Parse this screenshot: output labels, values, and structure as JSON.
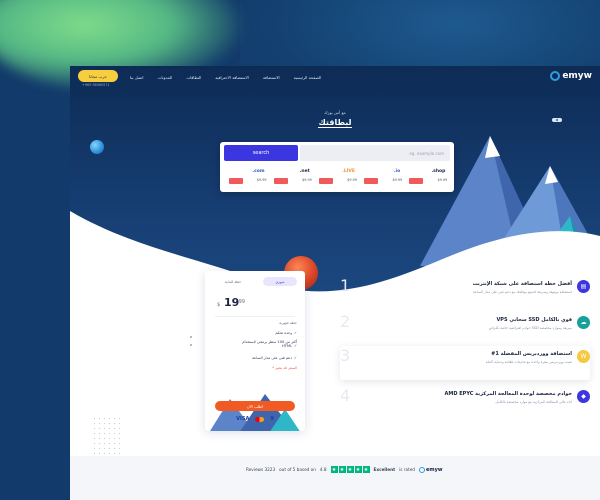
{
  "brand": {
    "name": "emyw"
  },
  "header": {
    "cta_label": "جرب مجانا",
    "phone": "+965 98960571",
    "nav": [
      "الصفحة الرئيسية",
      "الاستضافة",
      "الاستضافة الاحترافية",
      "النطاقات",
      "المدونات",
      "اتصل بنا"
    ]
  },
  "hero": {
    "subtitle": "مع أمن يوزك",
    "title": "لبطاقتك",
    "search": {
      "button_label": "search",
      "placeholder": "eg. example.com"
    },
    "domains": [
      {
        "ext": ".com",
        "price": "$9.99",
        "color": "#1e5db8"
      },
      {
        "ext": ".net",
        "price": "$9.99",
        "color": "#1b2340"
      },
      {
        "ext": ".LIVE",
        "price": "$9.99",
        "color": "#f2902f"
      },
      {
        "ext": ".io",
        "price": "$9.99",
        "color": "#3a5fa8"
      },
      {
        "ext": ".shop",
        "price": "$9.99",
        "color": "#1b2340"
      }
    ]
  },
  "pricing": {
    "tab_active": "شهري",
    "tab_other": "خطة البداية",
    "price": "19",
    "currency": "$",
    "cents": ".99",
    "label_top": "خطة شهرية",
    "features": [
      "وحدة تحكم",
      "أكثر من 100 سطر برمجي لاستخدام HTML",
      "دعم فني على مدار الساعة"
    ],
    "note": "* السعر قد يتغير",
    "order_label": "اطلب الآن",
    "payments": [
      "VISA",
      "9"
    ]
  },
  "features": [
    {
      "num": "1",
      "title": "أفضل خطة استضافة على شبكة الإنترنت",
      "desc": "استضافة موثوقة وسريعة لجميع مواقعك مع دعم فني على مدار الساعة",
      "icon": "server-icon",
      "color": "#3b36e0"
    },
    {
      "num": "2",
      "title": "VPS سحابي SSD قوي بالكامل",
      "desc": "خوادم افتراضية خاصة بأقراص SSD سريعة وموارد مخصصة",
      "icon": "cloud-icon",
      "color": "#17a19a"
    },
    {
      "num": "3",
      "title": "#1 استضافة ووردبريس المفضلة",
      "desc": "تثبيت ووردبريس بنقرة واحدة مع تحديثات تلقائية وحماية كاملة",
      "icon": "wordpress-icon",
      "color": "#f5c842"
    },
    {
      "num": "4",
      "title": "AMD EPYC خوادم مخصصة لوحدة المعالجة المركزية",
      "desc": "أداء عالي للمعالجة المركزية مع موارد مخصصة بالكامل",
      "icon": "cpu-icon",
      "color": "#3b36e0"
    }
  ],
  "rating": {
    "text_left": "Reviews 3223",
    "text_mid": "out of 5 based on",
    "score": "4.8",
    "label": "Excellent",
    "rated": "is rated",
    "brand": "emyw",
    "stars": 5
  }
}
